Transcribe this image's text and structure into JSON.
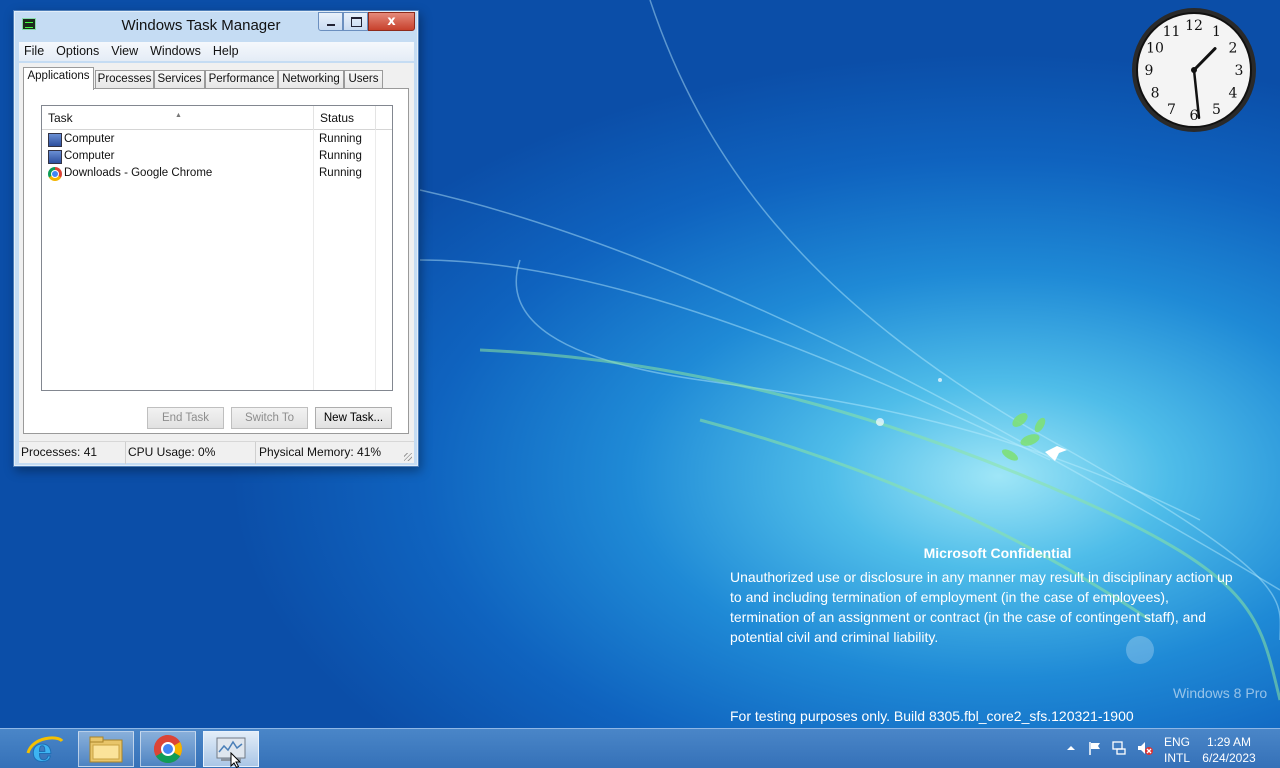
{
  "window": {
    "title": "Windows Task Manager",
    "close_label": "x"
  },
  "menu": [
    "File",
    "Options",
    "View",
    "Windows",
    "Help"
  ],
  "tabs": [
    "Applications",
    "Processes",
    "Services",
    "Performance",
    "Networking",
    "Users"
  ],
  "active_tab": "Applications",
  "list": {
    "columns": [
      "Task",
      "Status"
    ],
    "rows": [
      {
        "task": "Computer",
        "status": "Running",
        "icon": "computer-icon"
      },
      {
        "task": "Computer",
        "status": "Running",
        "icon": "computer-icon"
      },
      {
        "task": "Downloads - Google Chrome",
        "status": "Running",
        "icon": "chrome-icon"
      }
    ]
  },
  "buttons": {
    "end_task": "End Task",
    "switch_to": "Switch To",
    "new_task": "New Task..."
  },
  "statusbar": {
    "processes": "Processes: 41",
    "cpu": "CPU Usage: 0%",
    "memory": "Physical Memory: 41%"
  },
  "clock_gadget": {
    "numbers": [
      "12",
      "1",
      "2",
      "3",
      "4",
      "5",
      "6",
      "7",
      "8",
      "9",
      "10",
      "11"
    ],
    "hour": 1,
    "minute": 29
  },
  "watermark": {
    "title": "Microsoft Confidential",
    "lines": [
      "Unauthorized use or disclosure in any manner may result in disciplinary action up",
      "to and including termination of employment (in the case of employees),",
      "termination of an assignment or contract (in the case of contingent staff), and",
      "potential civil and criminal liability."
    ],
    "build": "For testing purposes only. Build 8305.fbl_core2_sfs.120321-1900",
    "edition": "Windows 8 Pro"
  },
  "taskbar": {
    "items": [
      {
        "name": "internet-explorer",
        "icon": "ie-icon"
      },
      {
        "name": "file-explorer",
        "icon": "folder-icon"
      },
      {
        "name": "google-chrome",
        "icon": "chrome-icon"
      },
      {
        "name": "task-manager",
        "icon": "task-manager-icon"
      }
    ],
    "tray_icons": [
      "show-hidden-icons-arrow",
      "flag-icon",
      "network-icon",
      "volume-muted-icon"
    ],
    "language": [
      "ENG",
      "INTL"
    ],
    "time": "1:29 AM",
    "date": "6/24/2023"
  },
  "colors": {
    "desktop_blue": "#1f8ad6",
    "taskbar_blue": "#3a76bc",
    "window_frame": "#c5dcf3",
    "close_red": "#c7412c"
  }
}
